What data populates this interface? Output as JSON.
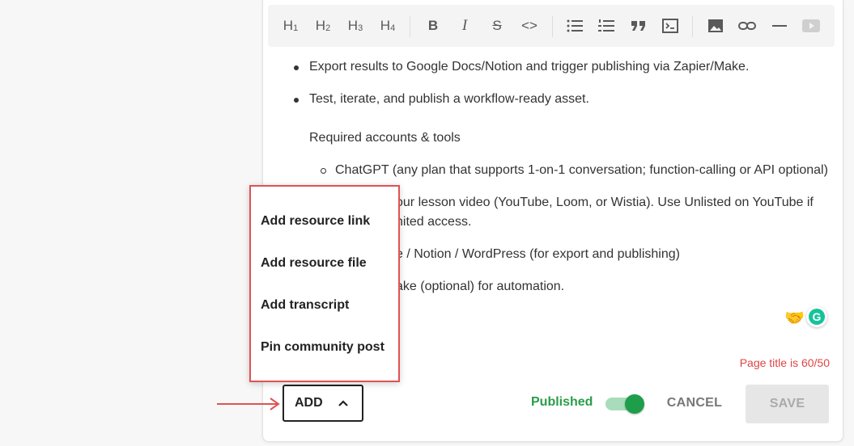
{
  "toolbar": {
    "buttons": [
      {
        "name": "heading-1-icon",
        "label": "H",
        "sub": "1"
      },
      {
        "name": "heading-2-icon",
        "label": "H",
        "sub": "2"
      },
      {
        "name": "heading-3-icon",
        "label": "H",
        "sub": "3"
      },
      {
        "name": "heading-4-icon",
        "label": "H",
        "sub": "4"
      }
    ],
    "bold": "B",
    "italic": "I",
    "strike": "S",
    "code": "<>"
  },
  "content": {
    "bullets": [
      "Export results to Google Docs/Notion and trigger publishing via Zapier/Make.",
      "Test, iterate, and publish a workflow-ready asset."
    ],
    "subheading": "Required accounts & tools",
    "sub_items": [
      "ChatGPT (any plan that supports 1-on-1 conversation; function-calling or API optional)",
      "our lesson video (YouTube, Loom, or Wistia). Use Unlisted on YouTube if",
      "nited access.",
      "e / Notion / WordPress (for export and publishing)",
      "ake (optional) for automation."
    ],
    "emoji": "🤝",
    "grammarly_letter": "G"
  },
  "status": {
    "title_warning": "Page title is 60/50"
  },
  "footer": {
    "add_label": "ADD",
    "published_label": "Published",
    "published_on": true,
    "cancel_label": "CANCEL",
    "save_label": "SAVE"
  },
  "add_menu": {
    "items": [
      "Add resource link",
      "Add resource file",
      "Add transcript",
      "Pin community post"
    ]
  },
  "colors": {
    "accent_green": "#1e9e4a",
    "warning_red": "#e04444",
    "highlight_red": "#e05252"
  }
}
